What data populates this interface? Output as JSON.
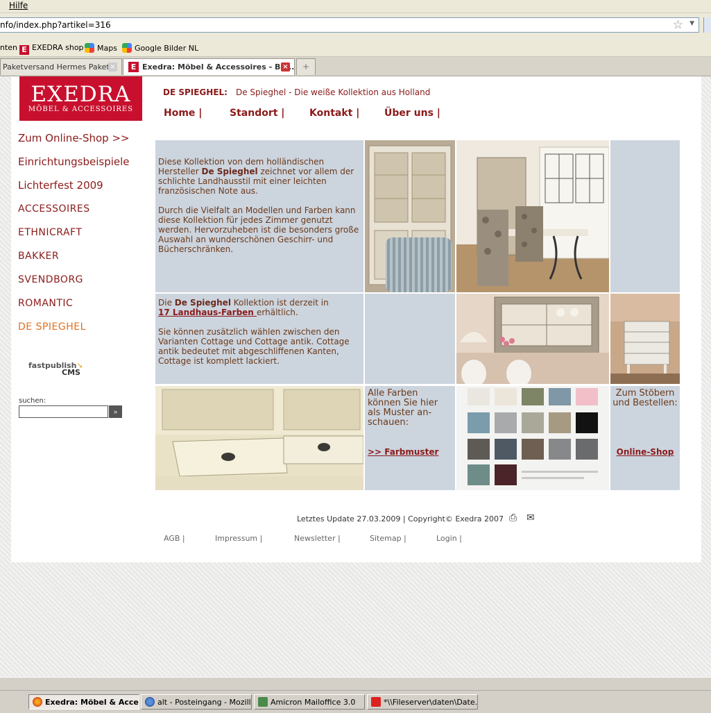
{
  "browser": {
    "menu_hilfe": "Hilfe",
    "url": "nfo/index.php?artikel=316",
    "bookmarks": [
      "nten",
      "EXEDRA shop",
      "Maps",
      "Google Bilder NL"
    ],
    "tabs": [
      {
        "label": "Paketversand Hermes Paket..."
      },
      {
        "label": "Exedra: Möbel & Accessoires - Be..."
      }
    ]
  },
  "site": {
    "logo_main": "EXEDRA",
    "logo_sub": "MÖBEL & ACCESSOIRES",
    "headline_label": "DE SPIEGHEL:",
    "headline_text": "De Spieghel - Die weiße Kollektion aus Holland",
    "topnav": [
      "Home |",
      "Standort |",
      "Kontakt |",
      "Über uns |"
    ],
    "sidenav": [
      "Zum Online-Shop >>",
      "Einrichtungsbeispiele",
      "Lichterfest 2009",
      "ACCESSOIRES",
      "ETHNICRAFT",
      "BAKKER",
      "SVENDBORG",
      "ROMANTIC",
      "DE SPIEGHEL"
    ],
    "cms_logo_top": "fastpublish",
    "cms_logo_bottom": "CMS",
    "search_label": "suchen:",
    "search_btn": "»"
  },
  "content": {
    "p1_a": "Diese Kollektion von dem holländischen Hersteller ",
    "p1_b": "De Spieghel",
    "p1_c": " zeichnet vor allem der schlichte Landhausstil mit einer leichten französischen Note aus.",
    "p2": "Durch die Vielfalt an Modellen und Farben kann diese Kollektion für jedes Zimmer genutzt werden. Hervorzuheben ist die besonders große Auswahl an wunderschönen Geschirr- und Bücherschränken.",
    "p3_a": "Die ",
    "p3_b": "De Spieghel",
    "p3_c": " Kollektion ist derzeit in",
    "p3_link": "17 Landhaus-Farben ",
    "p3_d": "erhältlich.",
    "p4": "Sie können zusätzlich wählen zwischen den Varianten Cottage und Cottage antik. Cottage antik bedeutet mit abgeschliffenen Kanten, Cottage ist komplett lackiert.",
    "farben_text": "Alle Farben können Sie hier als Muster an-schauen:",
    "farben_link": ">> Farbmuster",
    "shop_text": "Zum Stöbern und Bestellen:",
    "shop_link": "Online-Shop"
  },
  "footer": {
    "update": "Letztes Update 27.03.2009 | Copyright© Exedra 2007",
    "links": [
      "AGB |",
      "Impressum |",
      "Newsletter |",
      "Sitemap |",
      "Login |"
    ]
  },
  "taskbar": [
    "Exedra: Möbel & Acce...",
    "alt - Posteingang - Mozill...",
    "Amicron Mailoffice 3.0",
    "*\\\\Fileserver\\daten\\Date..."
  ],
  "colors": {
    "brand_red": "#c8102e",
    "link_red": "#8b1a1a",
    "current_orange": "#e07020",
    "cell_blue_grey": "#ccd4de"
  }
}
